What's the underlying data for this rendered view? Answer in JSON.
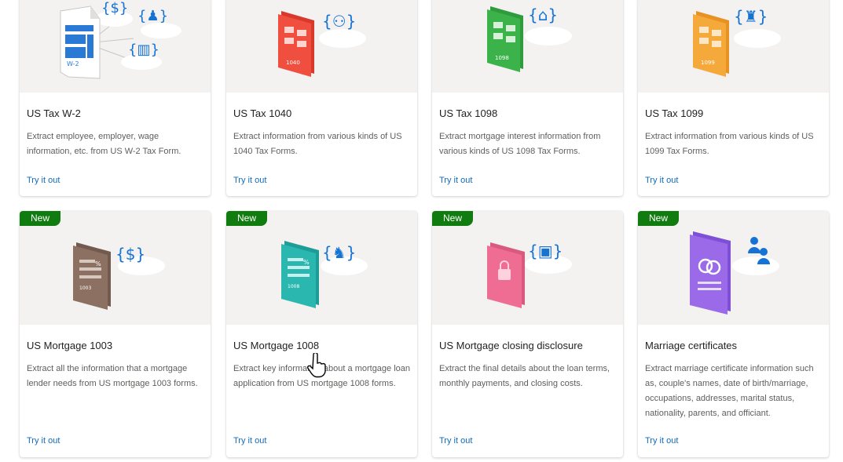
{
  "cards": [
    {
      "title": "US Tax W-2",
      "description": "Extract employee, employer, wage information, etc. from US W-2 Tax Form.",
      "cta": "Try it out",
      "badge": "",
      "doc_label": "W-2",
      "doc_color": "#2a7ad5"
    },
    {
      "title": "US Tax 1040",
      "description": "Extract information from various kinds of US 1040 Tax Forms.",
      "cta": "Try it out",
      "badge": "",
      "doc_label": "1040",
      "doc_color": "#f04e3e"
    },
    {
      "title": "US Tax 1098",
      "description": "Extract mortgage interest information from various kinds of US 1098 Tax Forms.",
      "cta": "Try it out",
      "badge": "",
      "doc_label": "1098",
      "doc_color": "#3cb34a"
    },
    {
      "title": "US Tax 1099",
      "description": "Extract information from various kinds of US 1099 Tax Forms.",
      "cta": "Try it out",
      "badge": "",
      "doc_label": "1099",
      "doc_color": "#f6a93b"
    },
    {
      "title": "US Mortgage 1003",
      "description": "Extract all the information that a mortgage lender needs from US mortgage 1003 forms.",
      "cta": "Try it out",
      "badge": "New",
      "doc_label": "1003",
      "doc_color": "#8c7062"
    },
    {
      "title": "US Mortgage 1008",
      "description": "Extract key information about a mortgage loan application from US mortgage 1008 forms.",
      "cta": "Try it out",
      "badge": "New",
      "doc_label": "1008",
      "doc_color": "#2ab7b0"
    },
    {
      "title": "US Mortgage closing disclosure",
      "description": "Extract the final details about the loan terms, monthly payments, and closing costs.",
      "cta": "Try it out",
      "badge": "New",
      "doc_label": "",
      "doc_color": "#ef6d92"
    },
    {
      "title": "Marriage certificates",
      "description": "Extract marriage certificate information such as, couple's names, date of birth/marriage, occupations, addresses, marital status, nationality, parents, and officiant.",
      "cta": "Try it out",
      "badge": "New",
      "doc_label": "",
      "doc_color": "#9b6ae8"
    }
  ],
  "colors": {
    "accent": "#0f6cbd",
    "badge": "#107c10",
    "hero_bg": "#f3f2f1",
    "icon_blue": "#1573d6"
  },
  "icons": [
    "dollar-icon",
    "person-icon",
    "building-icon",
    "people-icon",
    "house-icon",
    "lock-icon",
    "rings-icon",
    "hand-pointer-cursor"
  ]
}
